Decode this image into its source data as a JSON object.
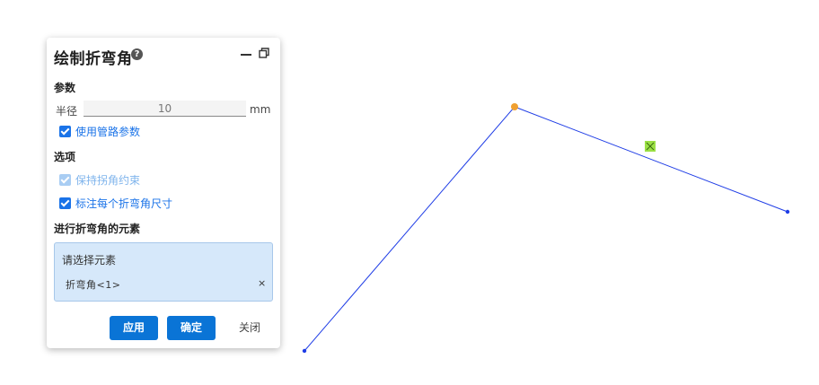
{
  "panel": {
    "title": "绘制折弯角",
    "help_icon": "help-icon",
    "params_header": "参数",
    "radius": {
      "label": "半径",
      "value": "10",
      "unit": "mm"
    },
    "use_pipe_params": {
      "label": "使用管路参数",
      "checked": true
    },
    "options_header": "选项",
    "keep_corner": {
      "label": "保持拐角约束",
      "checked": true,
      "disabled": true
    },
    "annotate_each": {
      "label": "标注每个折弯角尺寸",
      "checked": true
    },
    "elements_header": "进行折弯角的元素",
    "selection": {
      "placeholder": "请选择元素",
      "items": [
        {
          "label": "折弯角<1>",
          "remove": "×"
        }
      ]
    },
    "buttons": {
      "apply": "应用",
      "ok": "确定",
      "close": "关闭"
    }
  },
  "canvas": {
    "line_color": "#1f3de6",
    "vertex_color": "#f0a030",
    "midpoint_marker_color": "#9be045"
  }
}
